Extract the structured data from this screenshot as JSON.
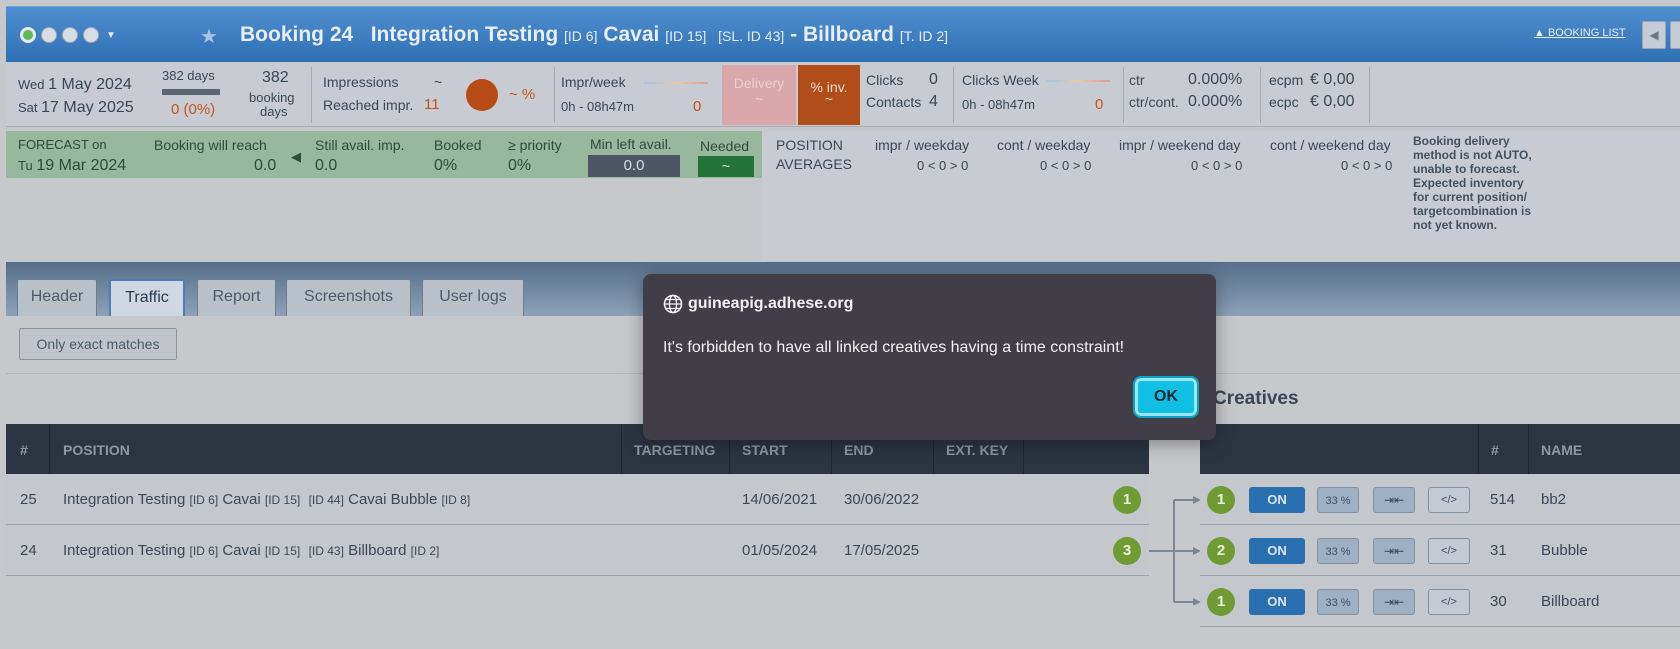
{
  "header": {
    "booking": "Booking 24",
    "campaign": "Integration Testing",
    "campaign_id": "[ID 6]",
    "advertiser": "Cavai",
    "advertiser_id": "[ID 15]",
    "slot": "[SL. ID 43]",
    "dash_creative": "- Billboard",
    "template_id": "[T. ID 2]",
    "booking_list": "▲ BOOKING LIST"
  },
  "stats": {
    "start_day": "Wed",
    "start_date": "1 May 2024",
    "end_day": "Sat",
    "end_date": "17 May 2025",
    "days_total": "382 days",
    "days_progress_fraction": 1.0,
    "days_done": "0 (0%)",
    "booking_days_num": "382",
    "booking_days_l1": "booking",
    "booking_days_l2": "days",
    "impressions_label": "Impressions",
    "impressions_value": "~",
    "reached_label": "Reached impr.",
    "reached_value": "11",
    "pct_value": "~ %",
    "impr_week_label": "Impr/week",
    "impr_week_time": "0h - 08h47m",
    "impr_week_value": "0",
    "delivery_label": "Delivery",
    "delivery_value": "~",
    "pinv_label": "% inv.",
    "pinv_value": "~",
    "clicks_label": "Clicks",
    "clicks_value": "0",
    "contacts_label": "Contacts",
    "contacts_value": "4",
    "clicks_week_label": "Clicks Week",
    "clicks_week_time": "0h - 08h47m",
    "clicks_week_value": "0",
    "ctr_label": "ctr",
    "ctr_value": "0.000%",
    "ctrcont_label": "ctr/cont.",
    "ctrcont_value": "0.000%",
    "ecpm_label": "ecpm",
    "ecpm_value": "€ 0,00",
    "ecpc_label": "ecpc",
    "ecpc_value": "€ 0,00"
  },
  "forecast": {
    "label": "FORECAST on",
    "day": "Tu",
    "date": "19 Mar 2024",
    "will_reach_label": "Booking will reach",
    "will_reach_value": "0.0",
    "still_label": "Still avail. imp.",
    "still_value": "0.0",
    "booked_label": "Booked",
    "booked_value": "0%",
    "priority_label": "≥ priority",
    "priority_value": "0%",
    "minleft_label": "Min left avail.",
    "minleft_value": "0.0",
    "needed_label": "Needed",
    "needed_value": "~"
  },
  "positions": {
    "label1": "POSITION",
    "label2": "AVERAGES",
    "cols": [
      "impr / weekday",
      "cont / weekday",
      "impr / weekend day",
      "cont / weekend day"
    ],
    "vals": [
      "0 < 0 > 0",
      "0 < 0 > 0",
      "0 < 0 > 0",
      "0 < 0 > 0"
    ],
    "note": "Booking delivery method is not AUTO, unable to forecast. Expected inventory for current position/ targetcombination is not yet known."
  },
  "tabs": [
    "Header",
    "Traffic",
    "Report",
    "Screenshots",
    "User logs"
  ],
  "filter_button": "Only exact matches",
  "creatives_title": "Creatives",
  "table": {
    "headers": [
      "#",
      "POSITION",
      "TARGETING",
      "START",
      "END",
      "EXT. KEY"
    ],
    "rows": [
      {
        "num": "25",
        "pos_main": "Integration Testing",
        "pos_id1": "[ID 6]",
        "pos_adv": "Cavai",
        "pos_id2": "[ID 15]",
        "pos_slot": "[ID 44]",
        "pos_name": "Cavai Bubble",
        "pos_id3": "[ID 8]",
        "start": "14/06/2021",
        "end": "30/06/2022",
        "badge": "1"
      },
      {
        "num": "24",
        "pos_main": "Integration Testing",
        "pos_id1": "[ID 6]",
        "pos_adv": "Cavai",
        "pos_id2": "[ID 15]",
        "pos_slot": "[ID 43]",
        "pos_name": "Billboard",
        "pos_id3": "[ID 2]",
        "start": "01/05/2024",
        "end": "17/05/2025",
        "badge": "3"
      }
    ]
  },
  "creatives": {
    "headers": [
      "#",
      "NAME"
    ],
    "rows": [
      {
        "badge": "1",
        "state": "ON",
        "pct": "33 %",
        "code": "</>",
        "num": "514",
        "name": "bb2"
      },
      {
        "badge": "2",
        "state": "ON",
        "pct": "33 %",
        "code": "</>",
        "num": "31",
        "name": "Bubble"
      },
      {
        "badge": "1",
        "state": "ON",
        "pct": "33 %",
        "code": "</>",
        "num": "30",
        "name": "Billboard"
      }
    ]
  },
  "dialog": {
    "host": "guineapig.adhese.org",
    "message": "It's forbidden to have all linked creatives having a time constraint!",
    "ok": "OK"
  }
}
